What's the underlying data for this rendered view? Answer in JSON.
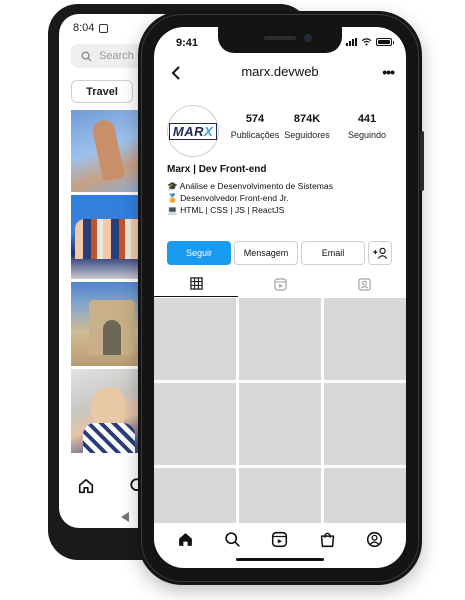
{
  "android": {
    "status_time": "8:04",
    "search_placeholder": "Search",
    "chip_label": "Travel"
  },
  "iphone": {
    "status_time": "9:41",
    "header": {
      "username": "marx.devweb"
    },
    "profile": {
      "logo_text": "MAR",
      "logo_accent": "X",
      "stats": [
        {
          "value": "574",
          "label": "Publicações"
        },
        {
          "value": "874K",
          "label": "Seguidores"
        },
        {
          "value": "441",
          "label": "Seguindo"
        }
      ],
      "name": "Marx | Dev Front-end",
      "bio": [
        {
          "emoji": "🎓",
          "text": "Análise e Desenvolvimento de Sistemas"
        },
        {
          "emoji": "🏅",
          "text": "Desenvolvedor Front-end Jr."
        },
        {
          "emoji": "💻",
          "text": "HTML | CSS | JS | ReactJS"
        }
      ],
      "buttons": {
        "follow": "Seguir",
        "message": "Mensagem",
        "email": "Email"
      }
    },
    "tabs": [
      "grid-icon",
      "reels-icon",
      "tagged-icon"
    ],
    "grid_cells": 9,
    "bottom_nav": [
      "home-icon",
      "search-icon",
      "reels-icon",
      "shop-icon",
      "profile-icon"
    ],
    "colors": {
      "accent": "#1a9aef",
      "placeholder": "#d8d8d8"
    }
  }
}
